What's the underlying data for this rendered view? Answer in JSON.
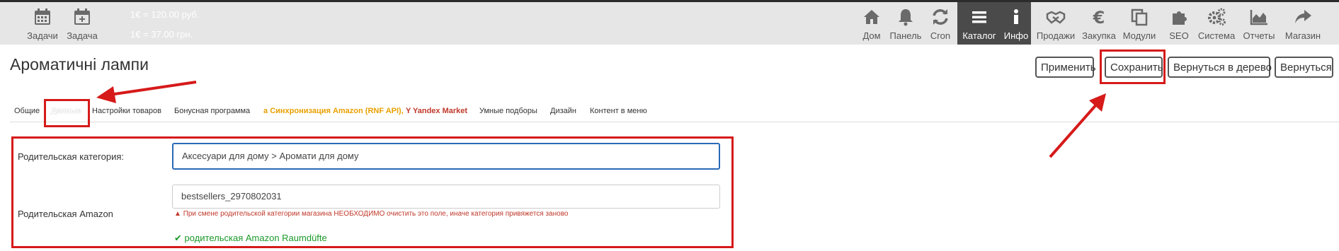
{
  "toolbar": {
    "left": [
      {
        "label": "Задачи",
        "icon": "calendar-icon"
      },
      {
        "label": "Задача",
        "icon": "calendar-plus-icon"
      }
    ],
    "rates": [
      "1€ = 120.00 руб.",
      "1€ = 37.00 грн."
    ],
    "right": [
      {
        "label": "Дом",
        "icon": "home-icon"
      },
      {
        "label": "Панель",
        "icon": "bell-icon"
      },
      {
        "label": "Cron",
        "icon": "refresh-icon"
      },
      {
        "label": "Каталог",
        "icon": "list-icon",
        "active": true
      },
      {
        "label": "Инфо",
        "icon": "info-icon"
      },
      {
        "label": "Продажи",
        "icon": "handshake-icon"
      },
      {
        "label": "Закупка",
        "icon": "euro-icon"
      },
      {
        "label": "Модули",
        "icon": "copy-icon"
      },
      {
        "label": "SEO",
        "icon": "puzzle-icon"
      },
      {
        "label": "Система",
        "icon": "gears-icon"
      },
      {
        "label": "Отчеты",
        "icon": "area-chart-icon"
      },
      {
        "label": "Магазин",
        "icon": "share-icon"
      }
    ]
  },
  "page": {
    "title": "Ароматичні лампи"
  },
  "actions": {
    "apply": "Применить",
    "save": "Сохранить",
    "back_tree": "Вернуться в дерево",
    "back": "Вернуться"
  },
  "tabs": {
    "general": "Общие",
    "data": "Данные",
    "product_settings": "Настройки товаров",
    "bonus": "Бонусная программа",
    "amazon_sync": "Синхронизация Amazon (RNF API),",
    "yandex": "Yandex Market",
    "smart": "Умные подборы",
    "design": "Дизайн",
    "menu_content": "Контент в меню"
  },
  "form": {
    "parent_label": "Родительская категория:",
    "parent_value": "Аксесуари для дому > Аромати для дому",
    "amazon_label": "Родительская Amazon",
    "amazon_value": "bestsellers_2970802031",
    "warning": "При смене родительской категории магазина НЕОБХОДИМО очистить это поле, иначе категория привяжется заново",
    "ok_text": "родительская Amazon Raumdüfte"
  },
  "colors": {
    "toolbar_bg": "#e6e6e6",
    "active_tab_bg": "#4a4a4a",
    "annotation_red": "#d61a1a",
    "focus_blue": "#2a6ab6",
    "amazon_orange": "#e8a000",
    "yandex_red": "#c0392b",
    "ok_green": "#1a9a2a"
  }
}
